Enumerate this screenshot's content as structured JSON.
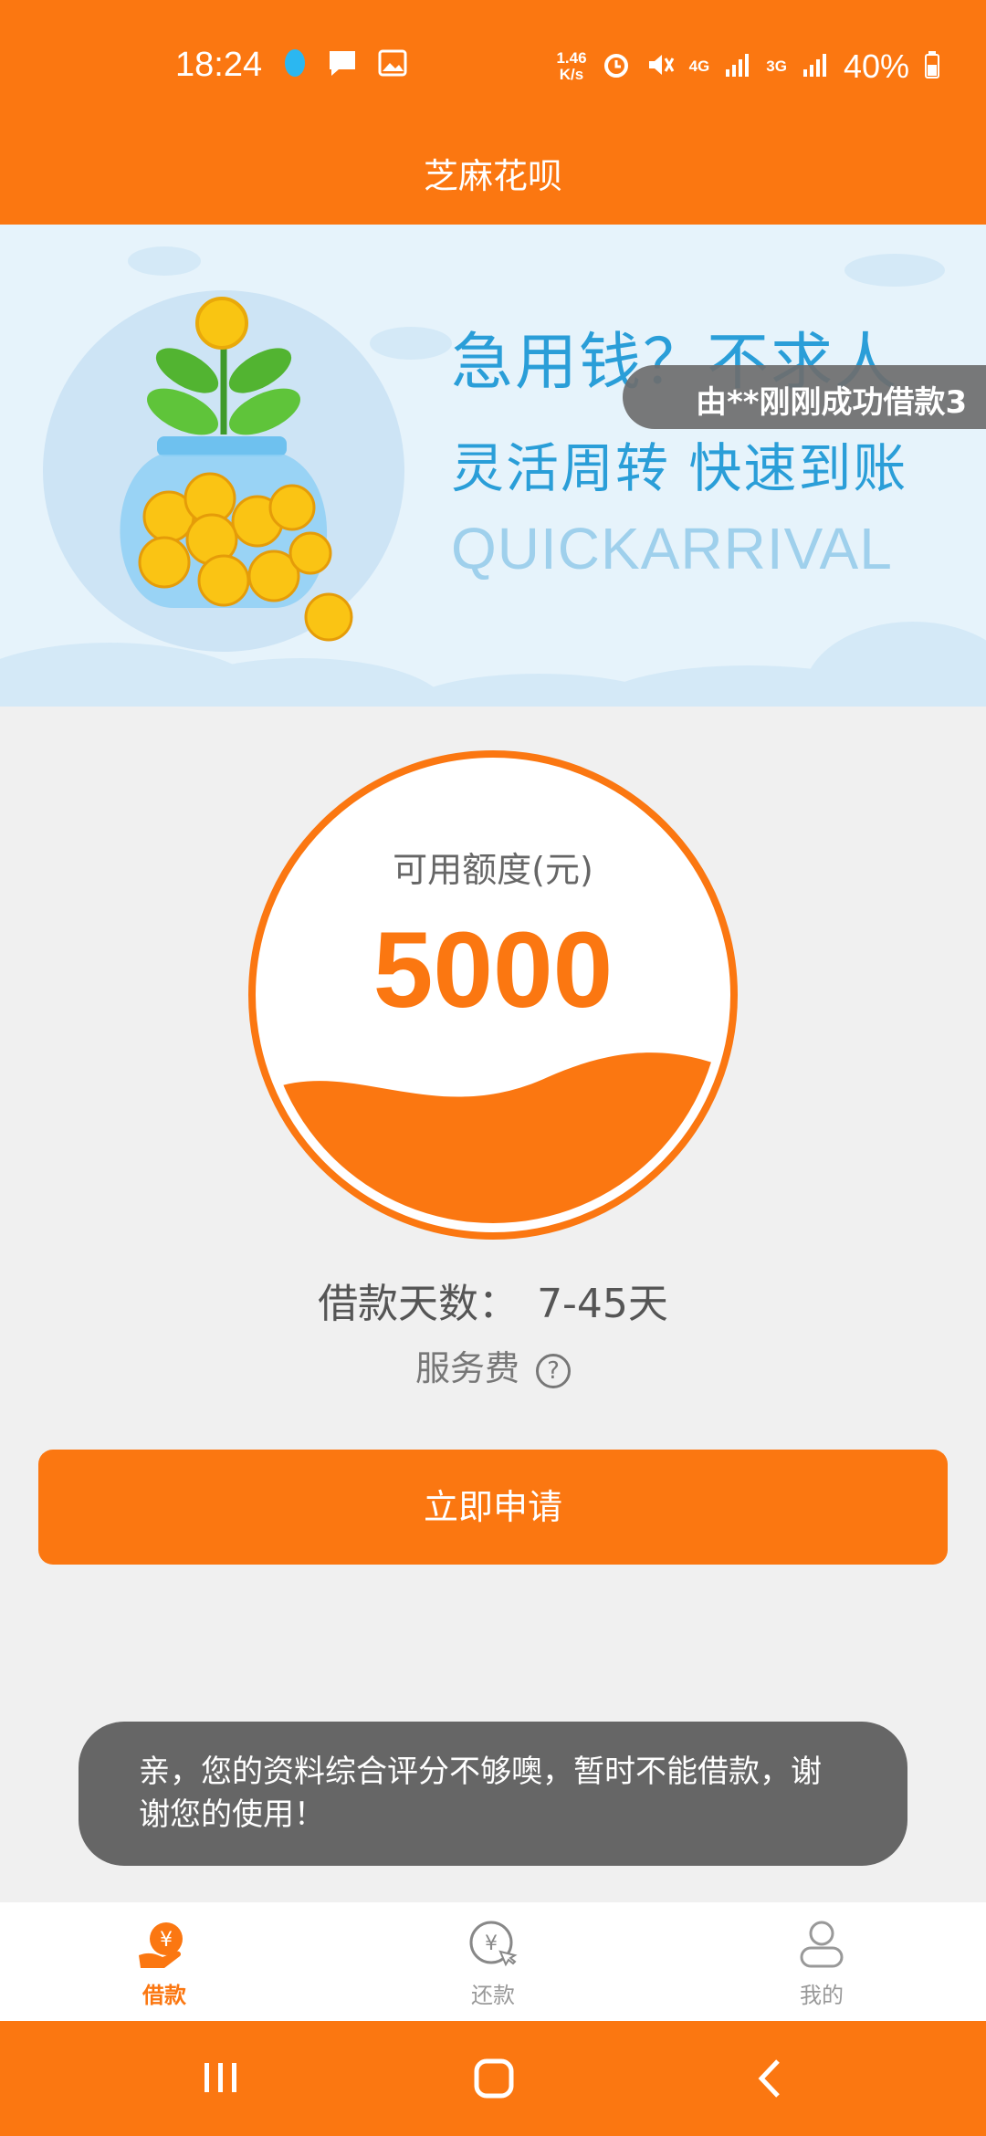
{
  "status_bar": {
    "time": "18:24",
    "net_speed_value": "1.46",
    "net_speed_unit": "K/s",
    "network_4g": "4G",
    "network_3g": "3G",
    "battery": "40%",
    "icons": [
      "qq-icon",
      "message-icon",
      "image-icon",
      "alarm-icon",
      "mute-icon",
      "signal-icon",
      "battery-icon"
    ]
  },
  "header": {
    "title": "芝麻花呗"
  },
  "banner": {
    "line1": "急用钱？不求人",
    "line2": "灵活周转 快速到账",
    "line3": "QUICKARRIVAL",
    "marquee": "由**刚刚成功借款3",
    "page_count": 2,
    "active_page": 1
  },
  "credit": {
    "label": "可用额度(元)",
    "amount": "5000",
    "accent_color": "#fb7711"
  },
  "loan": {
    "days_label": "借款天数：",
    "days_value": "7-45天",
    "service_fee_label": "服务费",
    "help_symbol": "?"
  },
  "apply_button": {
    "label": "立即申请"
  },
  "toast": {
    "message": "亲，您的资料综合评分不够噢，暂时不能借款，谢谢您的使用！"
  },
  "bottom_nav": {
    "items": [
      {
        "label": "借款",
        "icon": "loan-hand-icon",
        "active": true
      },
      {
        "label": "还款",
        "icon": "repay-icon",
        "active": false
      },
      {
        "label": "我的",
        "icon": "profile-icon",
        "active": false
      }
    ]
  },
  "colors": {
    "brand": "#fb7711",
    "banner_bg": "#e6f3fb",
    "banner_text": "#2a9ed8",
    "page_bg": "#f0f0f0"
  }
}
